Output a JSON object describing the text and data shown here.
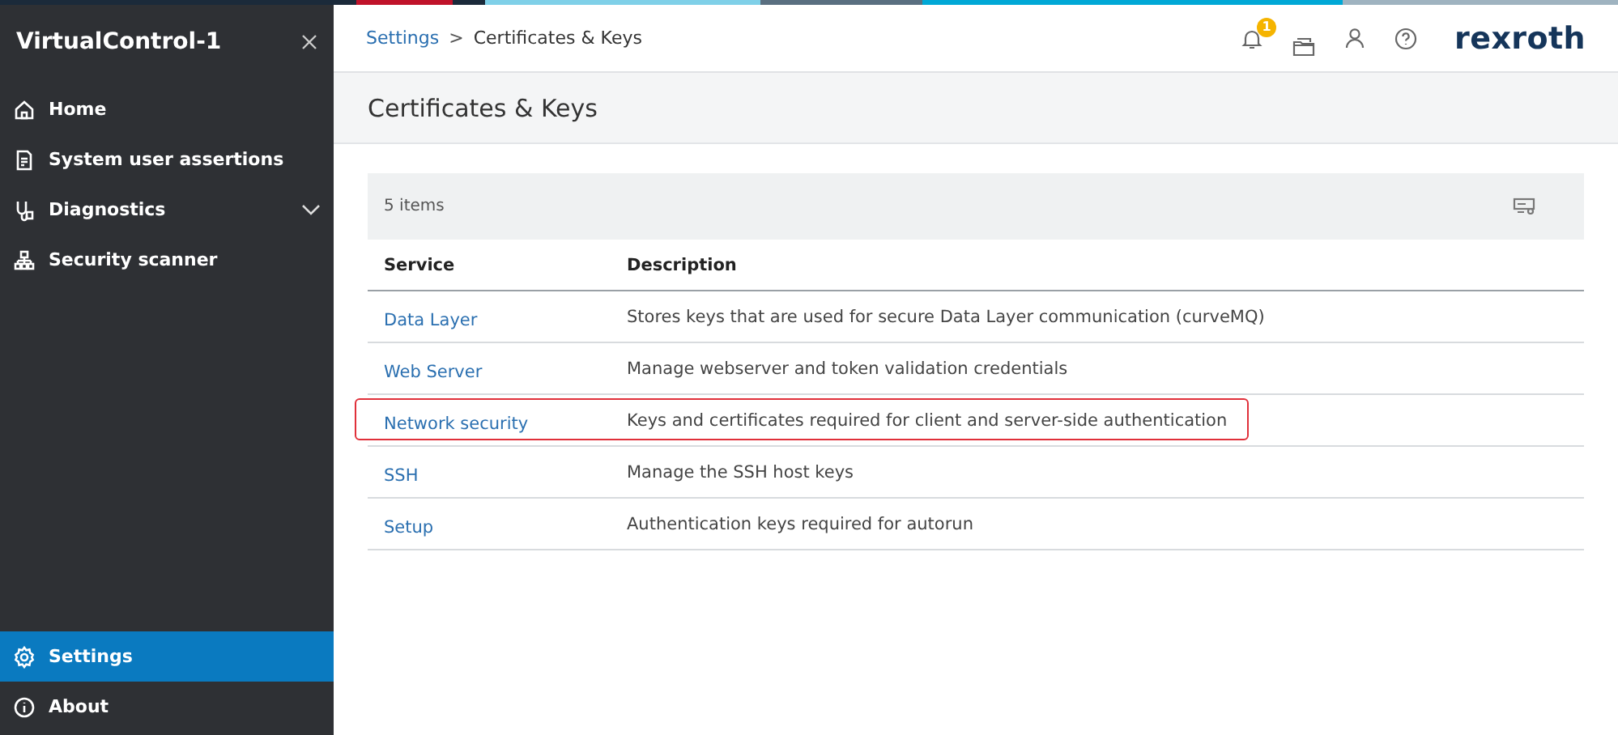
{
  "sidebar": {
    "title": "VirtualControl-1",
    "items": [
      {
        "label": "Home",
        "selected": false
      },
      {
        "label": "System user assertions",
        "selected": false
      },
      {
        "label": "Diagnostics",
        "selected": false,
        "expanded": false
      },
      {
        "label": "Security scanner",
        "selected": false
      }
    ],
    "bottom_items": [
      {
        "label": "Settings",
        "selected": true
      },
      {
        "label": "About",
        "selected": false
      }
    ]
  },
  "header": {
    "breadcrumb": [
      "Settings",
      "Certificates & Keys"
    ],
    "breadcrumb_separator": ">",
    "notification_count": "1",
    "logo": "rexroth"
  },
  "page_title": "Certificates & Keys",
  "table": {
    "count": "5 items",
    "columns": [
      "Service",
      "Description"
    ],
    "rows": [
      {
        "service": "Data Layer",
        "description": "Stores keys that are used for secure Data Layer communication (curveMQ)",
        "highlighted": false
      },
      {
        "service": "Web Server",
        "description": "Manage webserver and token validation credentials",
        "highlighted": false
      },
      {
        "service": "Network security",
        "description": "Keys and certificates required for client and server-side authentication",
        "highlighted": true
      },
      {
        "service": "SSH",
        "description": "Manage the SSH host keys",
        "highlighted": false
      },
      {
        "service": "Setup",
        "description": "Authentication keys required for autorun",
        "highlighted": false
      }
    ]
  }
}
